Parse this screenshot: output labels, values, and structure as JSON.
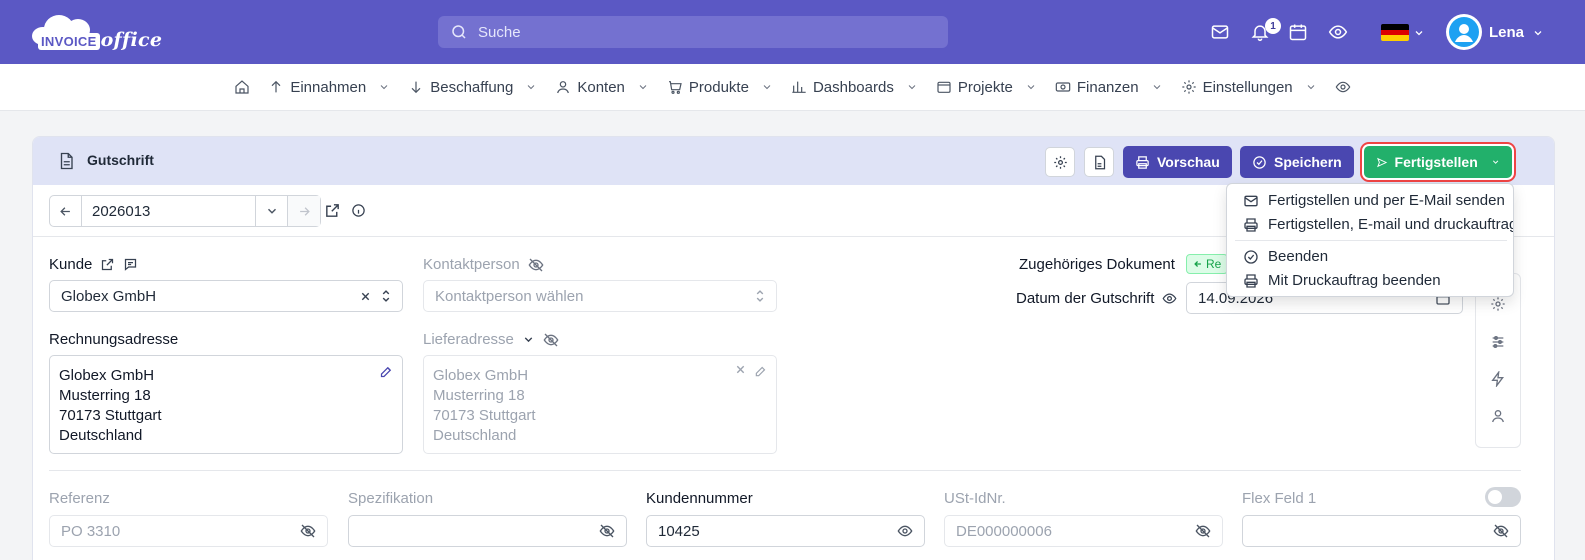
{
  "brand": {
    "logo_word1": "INVOICE",
    "logo_word2": "office"
  },
  "search": {
    "placeholder": "Suche"
  },
  "topbar": {
    "notification_count": "1",
    "user_name": "Lena",
    "accent": "#5b58c4"
  },
  "menu": [
    {
      "label": "Einnahmen",
      "icon": "arrow-up-icon"
    },
    {
      "label": "Beschaffung",
      "icon": "arrow-down-icon"
    },
    {
      "label": "Konten",
      "icon": "user-icon"
    },
    {
      "label": "Produkte",
      "icon": "cart-icon"
    },
    {
      "label": "Dashboards",
      "icon": "bar-chart-icon"
    },
    {
      "label": "Projekte",
      "icon": "folder-icon"
    },
    {
      "label": "Finanzen",
      "icon": "money-icon"
    },
    {
      "label": "Einstellungen",
      "icon": "gear-icon"
    }
  ],
  "document": {
    "title": "Gutschrift",
    "number": "2026013",
    "buttons": {
      "preview": "Vorschau",
      "save": "Speichern",
      "finish": "Fertigstellen"
    }
  },
  "finish_menu": [
    {
      "label": "Fertigstellen und per E-Mail senden",
      "icon": "mail-icon"
    },
    {
      "label": "Fertigstellen, E-mail und druckauftrag",
      "icon": "printer-icon"
    },
    {
      "label": "Beenden",
      "icon": "check-circle-icon"
    },
    {
      "label": "Mit Druckauftrag beenden",
      "icon": "printer-icon"
    }
  ],
  "form": {
    "customer_label": "Kunde",
    "customer_value": "Globex GmbH",
    "contact_label": "Kontaktperson",
    "contact_placeholder": "Kontaktperson wählen",
    "related_doc_label": "Zugehöriges Dokument",
    "related_doc_badge": "Re",
    "credit_date_label": "Datum der Gutschrift",
    "credit_date_value": "14.09.2026",
    "billing_label": "Rechnungsadresse",
    "billing_lines": [
      "Globex GmbH",
      "Musterring 18",
      "70173 Stuttgart",
      "Deutschland"
    ],
    "shipping_label": "Lieferadresse",
    "shipping_lines": [
      "Globex GmbH",
      "Musterring 18",
      "70173 Stuttgart",
      "Deutschland"
    ],
    "reference_label": "Referenz",
    "reference_placeholder": "PO 3310",
    "spec_label": "Spezifikation",
    "customer_no_label": "Kundennummer",
    "customer_no_value": "10425",
    "vat_label": "USt-IdNr.",
    "vat_placeholder": "DE000000006",
    "flex_label": "Flex Feld 1"
  }
}
